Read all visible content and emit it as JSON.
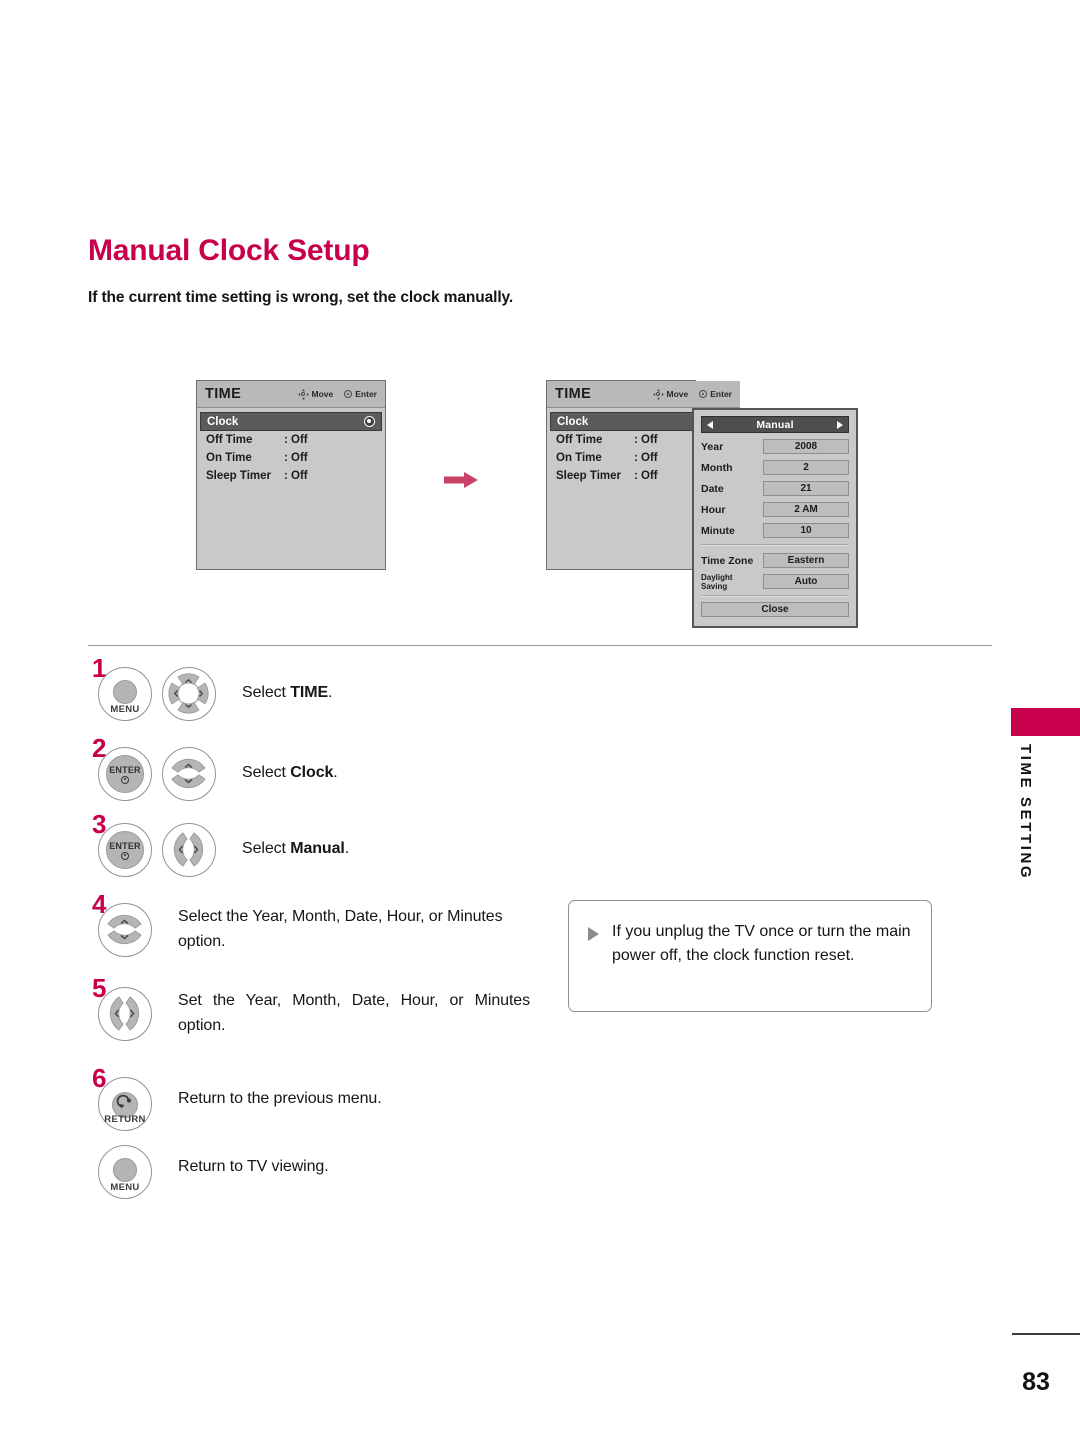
{
  "document": {
    "title": "Manual Clock Setup",
    "intro": "If the current time setting is wrong, set the clock manually.",
    "page_number": "83",
    "side_tab_label": "TIME SETTING",
    "accent_color": "#c8004b"
  },
  "osd_before": {
    "title": "TIME",
    "hints": {
      "move": "Move",
      "enter": "Enter"
    },
    "rows": [
      {
        "label": "Clock",
        "value": "",
        "selected": true
      },
      {
        "label": "Off Time",
        "value": ": Off",
        "selected": false
      },
      {
        "label": "On Time",
        "value": ": Off",
        "selected": false
      },
      {
        "label": "Sleep Timer",
        "value": ": Off",
        "selected": false
      }
    ]
  },
  "osd_after": {
    "title": "TIME",
    "hints": {
      "move": "Move",
      "enter": "Enter"
    },
    "rows": [
      {
        "label": "Clock",
        "value": "",
        "selected": true
      },
      {
        "label": "Off Time",
        "value": ": Off",
        "selected": false
      },
      {
        "label": "On Time",
        "value": ": Off",
        "selected": false
      },
      {
        "label": "Sleep Timer",
        "value": ": Off",
        "selected": false
      }
    ]
  },
  "manual_dialog": {
    "header_title": "Manual",
    "fields": [
      {
        "key": "Year",
        "value": "2008"
      },
      {
        "key": "Month",
        "value": "2"
      },
      {
        "key": "Date",
        "value": "21"
      },
      {
        "key": "Hour",
        "value": "2 AM"
      },
      {
        "key": "Minute",
        "value": "10"
      }
    ],
    "zone_fields": [
      {
        "key": "Time Zone",
        "value": "Eastern"
      },
      {
        "key": "Daylight Saving",
        "value": "Auto"
      }
    ],
    "close_label": "Close"
  },
  "steps": [
    {
      "number": "1",
      "buttons": [
        "MENU",
        "4-way-nav"
      ],
      "text_plain": "Select ",
      "text_bold": "TIME",
      "text_tail": "."
    },
    {
      "number": "2",
      "buttons": [
        "ENTER",
        "up-down"
      ],
      "text_plain": "Select ",
      "text_bold": "Clock",
      "text_tail": "."
    },
    {
      "number": "3",
      "buttons": [
        "ENTER",
        "left-right"
      ],
      "text_plain": "Select ",
      "text_bold": "Manual",
      "text_tail": "."
    },
    {
      "number": "4",
      "buttons": [
        "up-down"
      ],
      "text_plain": "Select the Year, Month, Date, Hour, or Minutes option.",
      "text_bold": "",
      "text_tail": ""
    },
    {
      "number": "5",
      "buttons": [
        "left-right"
      ],
      "text_plain": "Set the Year, Month, Date, Hour, or Minutes option.",
      "text_bold": "",
      "text_tail": ""
    },
    {
      "number": "6",
      "buttons": [
        "RETURN"
      ],
      "text_plain": "Return to the previous menu.",
      "text_bold": "",
      "text_tail": ""
    },
    {
      "number": "",
      "buttons": [
        "MENU"
      ],
      "text_plain": "Return to TV viewing.",
      "text_bold": "",
      "text_tail": ""
    }
  ],
  "note": {
    "text": "If you unplug the TV once or turn the main power off, the clock function reset."
  },
  "button_labels": {
    "menu": "MENU",
    "enter": "ENTER",
    "return": "RETURN"
  }
}
